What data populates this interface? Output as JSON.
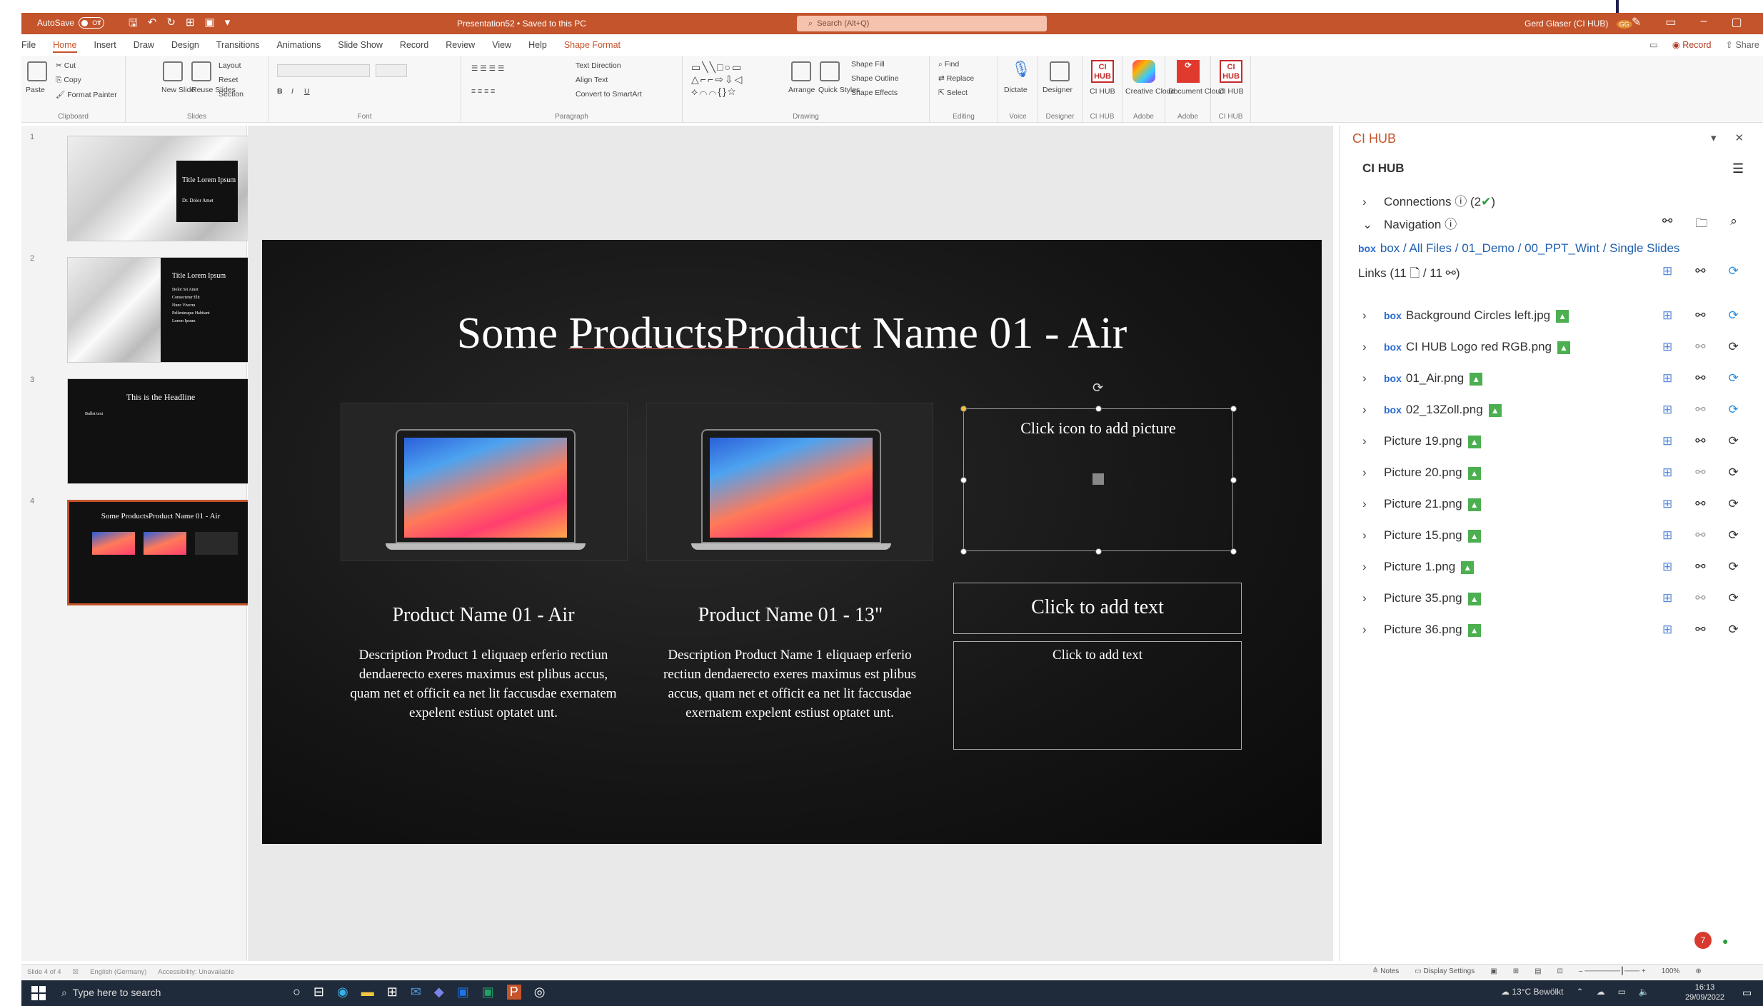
{
  "titlebar": {
    "autosave_label": "AutoSave",
    "autosave_state": "Off",
    "doc_title": "Presentation52 • Saved to this PC",
    "search_placeholder": "Search (Alt+Q)",
    "user": "Gerd Glaser (CI HUB)",
    "user_initials": "GG"
  },
  "tabs": [
    "File",
    "Home",
    "Insert",
    "Draw",
    "Design",
    "Transitions",
    "Animations",
    "Slide Show",
    "Record",
    "Review",
    "View",
    "Help",
    "Shape Format"
  ],
  "active_tab": "Home",
  "record_label": "Record",
  "share_label": "Share",
  "ribbon": {
    "clipboard": {
      "label": "Clipboard",
      "paste": "Paste",
      "cut": "Cut",
      "copy": "Copy",
      "format_painter": "Format Painter"
    },
    "slides": {
      "label": "Slides",
      "new_slide": "New Slide",
      "reuse": "Reuse Slides",
      "layout": "Layout",
      "reset": "Reset",
      "section": "Section"
    },
    "font": {
      "label": "Font"
    },
    "paragraph": {
      "label": "Paragraph",
      "text_direction": "Text Direction",
      "align_text": "Align Text",
      "smartart": "Convert to SmartArt"
    },
    "drawing": {
      "label": "Drawing",
      "arrange": "Arrange",
      "quick_styles": "Quick Styles",
      "shape_fill": "Shape Fill",
      "shape_outline": "Shape Outline",
      "shape_effects": "Shape Effects"
    },
    "editing": {
      "label": "Editing",
      "find": "Find",
      "replace": "Replace",
      "select": "Select"
    },
    "voice": {
      "label": "Voice",
      "dictate": "Dictate"
    },
    "designer": {
      "label": "Designer",
      "designer": "Designer"
    },
    "cihub1": {
      "label": "CI HUB",
      "btn": "CI HUB",
      "logo": "CI HUB"
    },
    "adobe1": {
      "label": "Adobe",
      "btn": "Creative Cloud"
    },
    "adobe2": {
      "label": "Adobe",
      "btn": "Document Cloud"
    },
    "cihub2": {
      "label": "CI HUB",
      "btn": "CI HUB",
      "logo": "CI HUB"
    }
  },
  "thumbnails": [
    {
      "num": "1",
      "title": "Title Lorem Ipsum",
      "subtitle": "Dr. Dolor Amet"
    },
    {
      "num": "2",
      "title": "Title Lorem Ipsum",
      "lines": [
        "Dolor Sit Amet",
        "Consectetur Elit",
        "Nunc Viverra",
        "Pellentesque Habitant",
        "Lorem Ipsum"
      ]
    },
    {
      "num": "3",
      "title": "This is the Headline",
      "lines": [
        "Bullet text"
      ]
    },
    {
      "num": "4",
      "title": "Some ProductsProduct Name 01 - Air"
    }
  ],
  "slide": {
    "title_prefix": "Some ",
    "title_underlined": "ProductsProduct",
    "title_suffix": " Name 01 - Air",
    "placeholder_pic": "Click icon to add picture",
    "product1": {
      "name": "Product Name 01 - Air",
      "desc": "Description Product 1 eliquaep erferio rectiun dendaerecto exeres maximus est plibus accus, quam net et officit ea net lit faccusdae exernatem expelent estiust optatet unt."
    },
    "product2": {
      "name": "Product Name 01 - 13\"",
      "desc": "Description Product Name 1 eliquaep erferio rectiun dendaerecto exeres maximus est plibus accus, quam net et officit ea net lit faccusdae exernatem expelent estiust optatet unt."
    },
    "placeholder_title": "Click to add text",
    "placeholder_body": "Click to add text"
  },
  "panel": {
    "header": "CI HUB",
    "sub": "CI HUB",
    "connections_label": "Connections",
    "connections_count": "(2",
    "navigation_label": "Navigation",
    "breadcrumb": "box / All Files / 01_Demo / 00_PPT_Wint / Single Slides",
    "links_label": "Links (11",
    "links_mid": "/ 11",
    "box_brand": "box",
    "items": [
      {
        "name": "Background Circles left.jpg",
        "box": true
      },
      {
        "name": "CI HUB Logo red RGB.png",
        "box": true
      },
      {
        "name": "01_Air.png",
        "box": true
      },
      {
        "name": "02_13Zoll.png",
        "box": true
      },
      {
        "name": "Picture 19.png",
        "box": false
      },
      {
        "name": "Picture 20.png",
        "box": false
      },
      {
        "name": "Picture 21.png",
        "box": false
      },
      {
        "name": "Picture 15.png",
        "box": false
      },
      {
        "name": "Picture 1.png",
        "box": false
      },
      {
        "name": "Picture 35.png",
        "box": false
      },
      {
        "name": "Picture 36.png",
        "box": false
      }
    ],
    "notification_count": "7"
  },
  "status": {
    "slide": "Slide 4 of 4",
    "lang": "English (Germany)",
    "accessibility": "Accessibility: Unavailable",
    "notes": "Notes",
    "display": "Display Settings",
    "zoom": "100%"
  },
  "taskbar": {
    "search": "Type here to search",
    "weather": "13°C Bewölkt",
    "time": "16:13",
    "date": "29/09/2022"
  },
  "colors": {
    "accent": "#c4542b",
    "slide_bg": "#151515",
    "taskbar": "#1f2a3a",
    "cihub_red": "#c42b2b"
  }
}
